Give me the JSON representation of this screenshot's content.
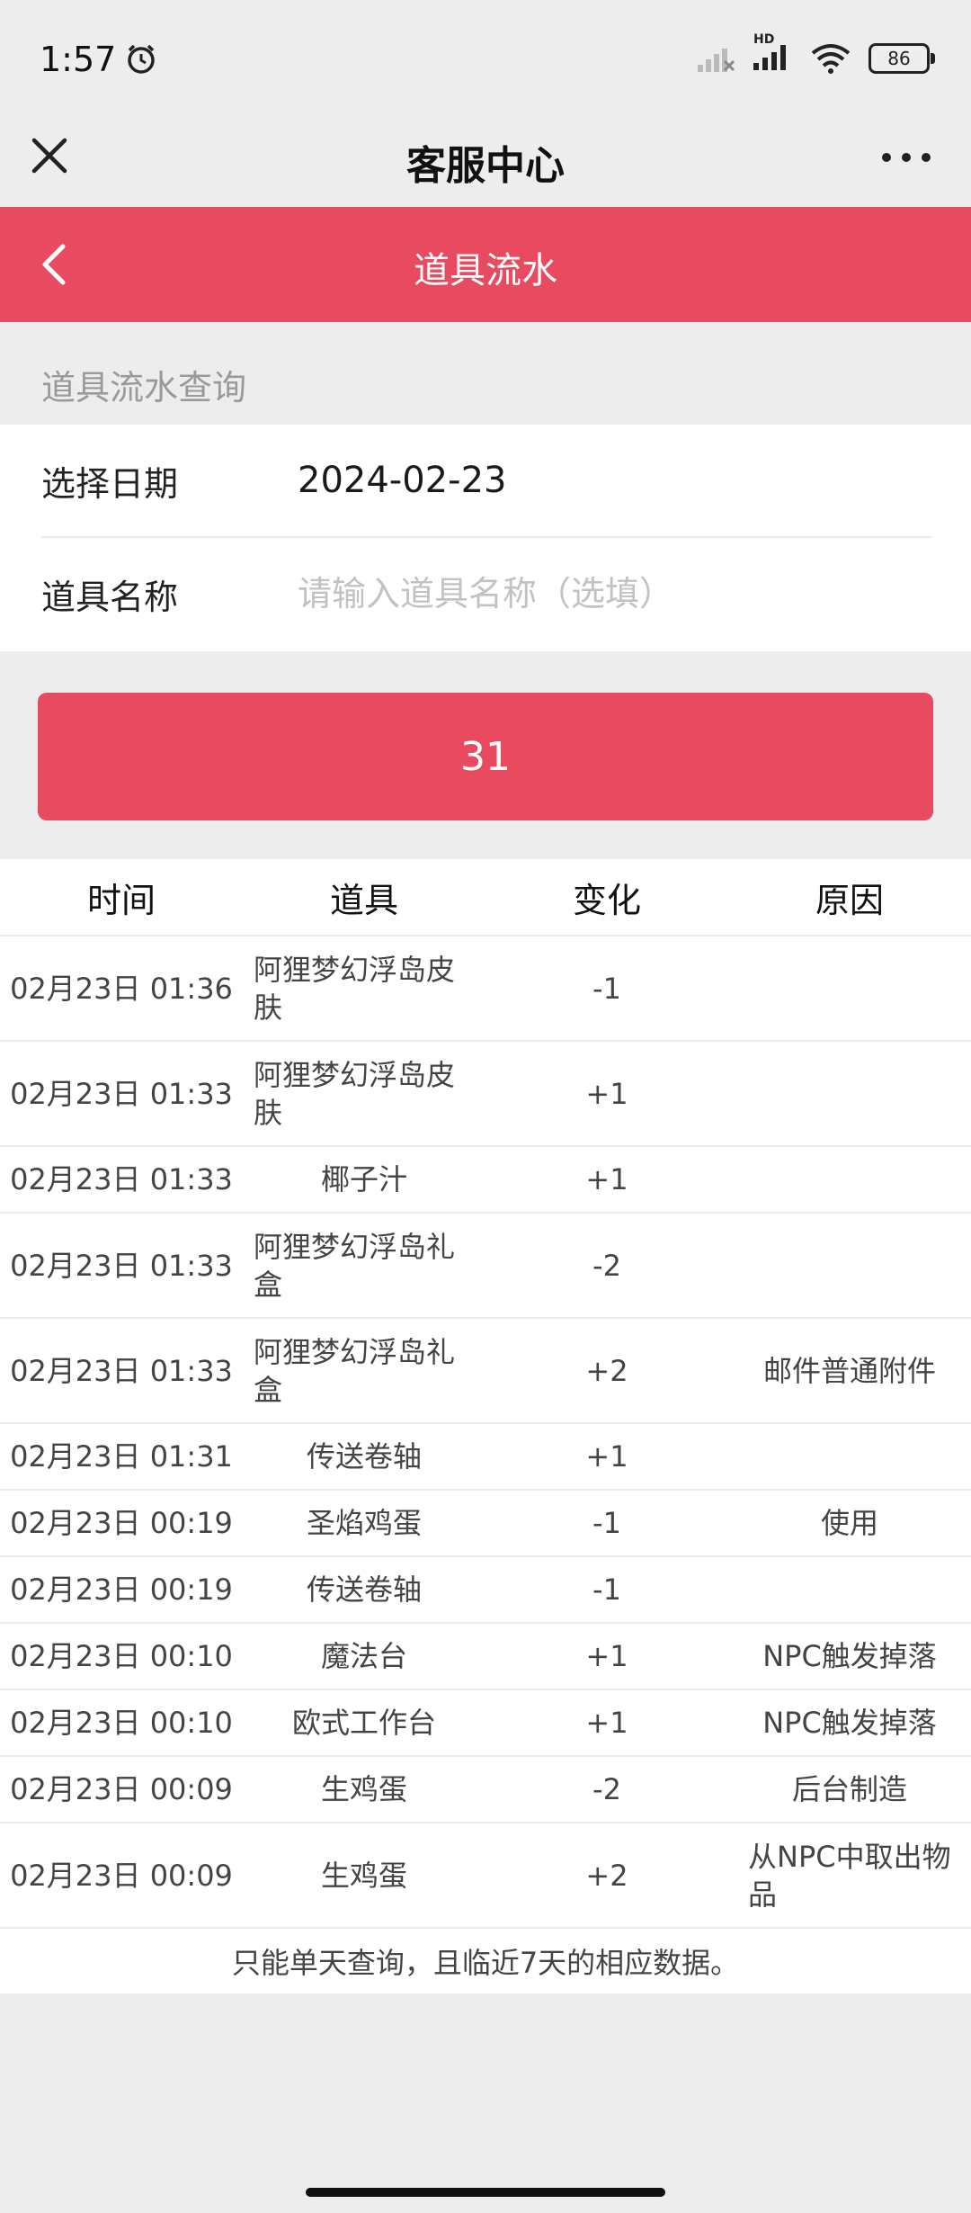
{
  "status": {
    "time": "1:57",
    "battery": "86",
    "network": "HD"
  },
  "nav": {
    "title": "客服中心"
  },
  "header": {
    "title": "道具流水"
  },
  "section": {
    "title": "道具流水查询"
  },
  "form": {
    "date_label": "选择日期",
    "date_value": "2024-02-23",
    "item_label": "道具名称",
    "item_placeholder": "请输入道具名称（选填）"
  },
  "query_button": {
    "label": "31"
  },
  "table": {
    "headers": [
      "时间",
      "道具",
      "变化",
      "原因"
    ],
    "rows": [
      {
        "time": "02月23日 01:36",
        "item": "阿狸梦幻浮岛皮肤",
        "change": "-1",
        "reason": ""
      },
      {
        "time": "02月23日 01:33",
        "item": "阿狸梦幻浮岛皮肤",
        "change": "+1",
        "reason": ""
      },
      {
        "time": "02月23日 01:33",
        "item": "椰子汁",
        "change": "+1",
        "reason": ""
      },
      {
        "time": "02月23日 01:33",
        "item": "阿狸梦幻浮岛礼盒",
        "change": "-2",
        "reason": ""
      },
      {
        "time": "02月23日 01:33",
        "item": "阿狸梦幻浮岛礼盒",
        "change": "+2",
        "reason": "邮件普通附件"
      },
      {
        "time": "02月23日 01:31",
        "item": "传送卷轴",
        "change": "+1",
        "reason": ""
      },
      {
        "time": "02月23日 00:19",
        "item": "圣焰鸡蛋",
        "change": "-1",
        "reason": "使用"
      },
      {
        "time": "02月23日 00:19",
        "item": "传送卷轴",
        "change": "-1",
        "reason": ""
      },
      {
        "time": "02月23日 00:10",
        "item": "魔法台",
        "change": "+1",
        "reason": "NPC触发掉落"
      },
      {
        "time": "02月23日 00:10",
        "item": "欧式工作台",
        "change": "+1",
        "reason": "NPC触发掉落"
      },
      {
        "time": "02月23日 00:09",
        "item": "生鸡蛋",
        "change": "-2",
        "reason": "后台制造"
      },
      {
        "time": "02月23日 00:09",
        "item": "生鸡蛋",
        "change": "+2",
        "reason": "从NPC中取出物品"
      }
    ],
    "note": "只能单天查询，且临近7天的相应数据。"
  }
}
